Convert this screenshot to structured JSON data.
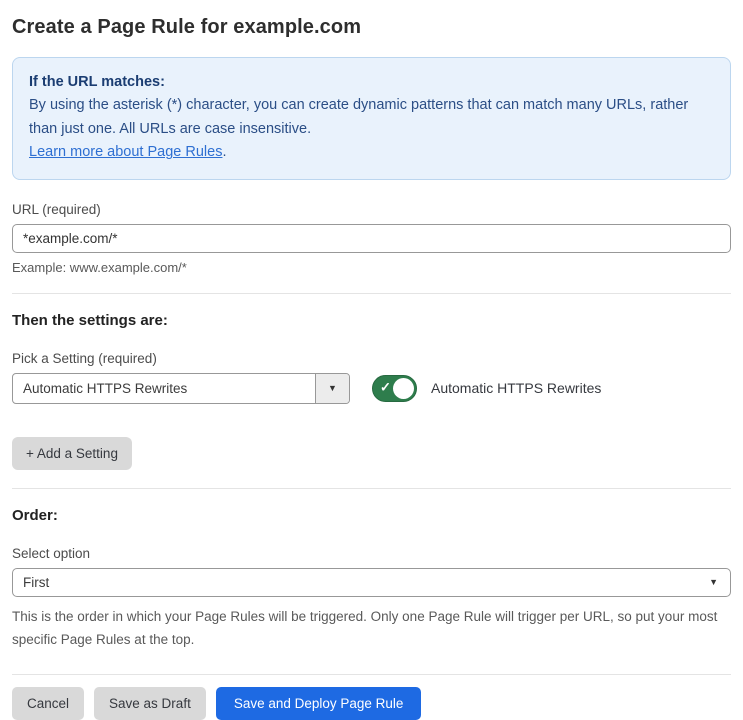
{
  "page": {
    "title": "Create a Page Rule for example.com"
  },
  "info_box": {
    "heading": "If the URL matches:",
    "body": "By using the asterisk (*) character, you can create dynamic patterns that can match many URLs, rather than just one. All URLs are case insensitive.",
    "link_label": "Learn more about Page Rules",
    "link_suffix": "."
  },
  "url_field": {
    "label": "URL (required)",
    "value": "*example.com/*",
    "hint": "Example: www.example.com/*"
  },
  "settings_section": {
    "heading": "Then the settings are:",
    "picker_label": "Pick a Setting (required)",
    "picker_value": "Automatic HTTPS Rewrites",
    "picker_arrow": "▼",
    "toggle_state": "on",
    "toggle_check": "✓",
    "toggle_label": "Automatic HTTPS Rewrites",
    "add_button_label": "+ Add a Setting"
  },
  "order_section": {
    "heading": "Order:",
    "select_label": "Select option",
    "select_value": "First",
    "select_arrow": "▼",
    "help": "This is the order in which your Page Rules will be triggered. Only one Page Rule will trigger per URL, so put your most specific Page Rules at the top."
  },
  "footer": {
    "cancel_label": "Cancel",
    "save_draft_label": "Save as Draft",
    "save_deploy_label": "Save and Deploy Page Rule"
  },
  "colors": {
    "toggle_on_green": "#2e7d4c",
    "primary_button_blue": "#1e6ae3",
    "info_box_background": "#e9f2fc",
    "info_box_border": "#bcd6ef",
    "info_text_blue": "#2b4e86",
    "link_blue": "#2e6fd2",
    "gray_button": "#d9d9d9"
  }
}
